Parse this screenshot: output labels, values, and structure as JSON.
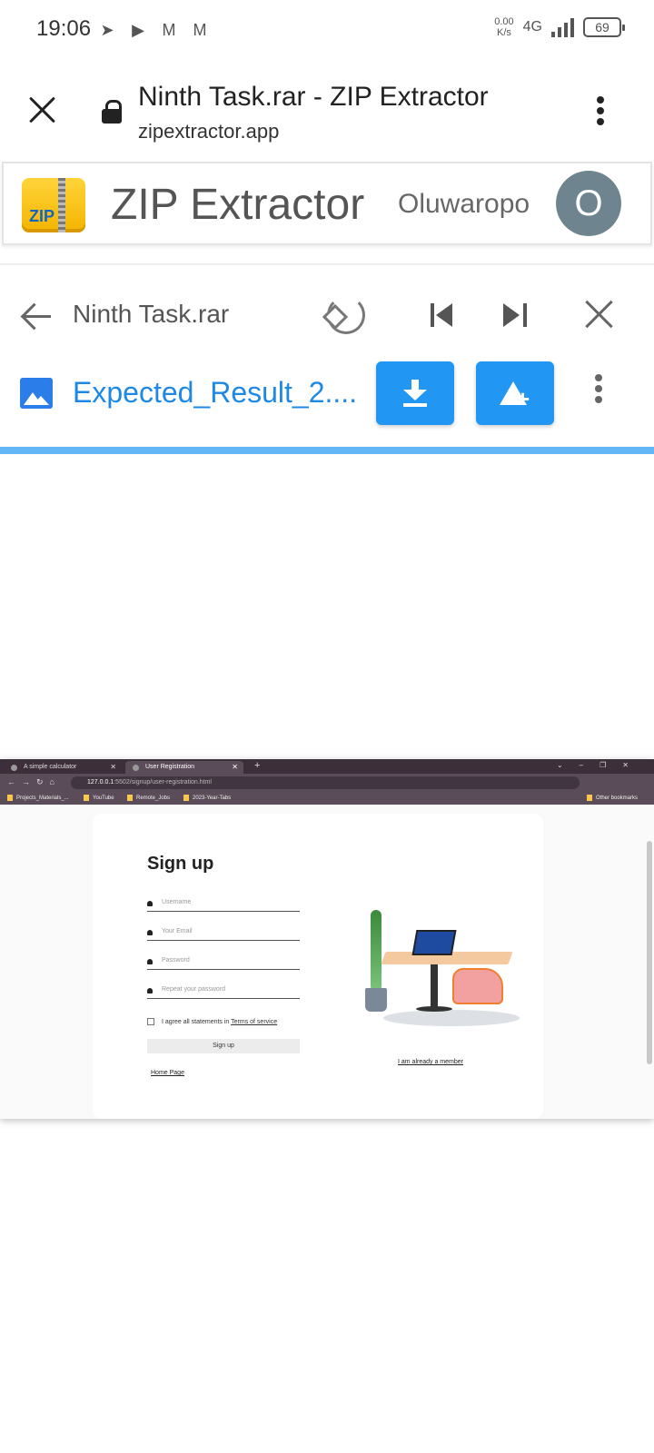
{
  "status_bar": {
    "time": "19:06",
    "net_speed_value": "0.00",
    "net_speed_unit": "K/s",
    "network_type": "4G",
    "battery": "69"
  },
  "browser": {
    "page_title": "Ninth Task.rar - ZIP Extractor",
    "domain": "zipextractor.app"
  },
  "app": {
    "logo_text": "ZIP",
    "name": "ZIP Extractor",
    "user_name": "Oluwaropo",
    "avatar_initial": "O"
  },
  "viewer": {
    "archive_name": "Ninth Task.rar",
    "file_name": "Expected_Result_2....",
    "colors": {
      "accent": "#2196f3",
      "link": "#1e88e5",
      "progress": "#64b5f6"
    }
  },
  "preview": {
    "tabs": [
      {
        "label": "A simple calculator"
      },
      {
        "label": "User Registration"
      }
    ],
    "url_host": "127.0.0.1",
    "url_rest": ":5502/signup/user-registration.html",
    "bookmarks": [
      "Projects_Materials_...",
      "YouTube",
      "Remote_Jobs",
      "2023-Year-Tabs"
    ],
    "other_bookmarks": "Other bookmarks",
    "form": {
      "title": "Sign up",
      "fields": [
        "Username",
        "Your Email",
        "Password",
        "Repeat your password"
      ],
      "agree_text": "I agree all statements in ",
      "terms_link": "Terms of service",
      "submit_label": "Sign up",
      "home_link": "Home Page",
      "member_link": "I am already a member"
    }
  }
}
